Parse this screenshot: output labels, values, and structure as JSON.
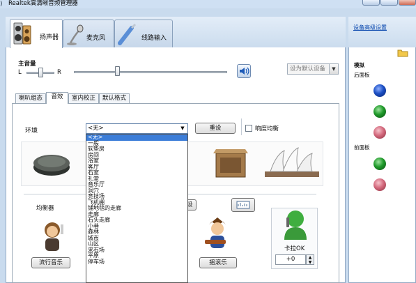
{
  "window": {
    "title": "Realtek高清晰音频管理器",
    "icon": "speaker-icon"
  },
  "device_tabs": [
    {
      "label": "扬声器",
      "icon": "speakers-icon",
      "active": true
    },
    {
      "label": "麦克风",
      "icon": "microphone-icon",
      "active": false
    },
    {
      "label": "线路输入",
      "icon": "line-in-icon",
      "active": false
    }
  ],
  "volume": {
    "label": "主音量",
    "left": "L",
    "right": "R",
    "balance": 0.5,
    "level": 0.3
  },
  "set_default": {
    "label": "设为默认设备"
  },
  "sub_tabs": [
    {
      "label": "喇叭组态",
      "active": false
    },
    {
      "label": "音效",
      "active": true
    },
    {
      "label": "室内校正",
      "active": false
    },
    {
      "label": "默认格式",
      "active": false
    }
  ],
  "environment": {
    "label": "环境",
    "selected": "<无>",
    "reset_label": "重设",
    "loudness_label": "响度均衡",
    "options": [
      "<无>",
      "一般",
      "软垫房",
      "房间",
      "浴室",
      "客厅",
      "石室",
      "礼堂",
      "音乐厅",
      "洞穴",
      "竞技场",
      "飞机棚",
      "铺地毯的走廊",
      "走廊",
      "石头走廊",
      "小巷",
      "森林",
      "城市",
      "山区",
      "采石场",
      "平原",
      "停车场"
    ]
  },
  "equalizer": {
    "label": "均衡器",
    "reset_partial": "设",
    "pop_label": "流行音乐",
    "rock_label": "摇滚乐"
  },
  "karaoke": {
    "label": "卡拉OK",
    "value": "+0"
  },
  "right_panel": {
    "link": "设备高级设置",
    "analog": "模拟",
    "back": "后面板",
    "front": "前面板"
  },
  "colors": {
    "blue_jack": "#1b4fc4",
    "green_jack": "#1f9a2a",
    "pink_jack": "#d46a7e"
  }
}
